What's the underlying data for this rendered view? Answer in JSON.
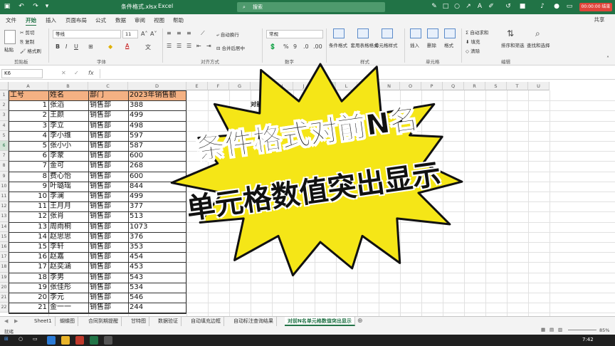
{
  "window": {
    "filename": "条件格式.xlsx",
    "app": "Excel",
    "search_placeholder": "搜索",
    "recording": "00:00:00 结束"
  },
  "ribbon_tabs": [
    "文件",
    "开始",
    "插入",
    "页面布局",
    "公式",
    "数据",
    "审阅",
    "视图",
    "帮助"
  ],
  "share_label": "共享",
  "ribbon": {
    "clipboard": {
      "label": "剪贴板",
      "cut": "剪切",
      "copy": "复制",
      "format_painter": "格式刷",
      "paste": "粘贴"
    },
    "font": {
      "label": "字体",
      "name": "等线",
      "size": "11"
    },
    "alignment": {
      "label": "对齐方式",
      "wrap": "自动换行",
      "merge": "合并后居中"
    },
    "number": {
      "label": "数字",
      "format": "常规"
    },
    "styles": {
      "label": "样式",
      "conditional": "条件格式",
      "table": "套用表格格式",
      "cell_styles": "单元格样式"
    },
    "cells": {
      "label": "单元格",
      "insert": "插入",
      "delete": "删除",
      "format": "格式"
    },
    "editing": {
      "label": "编辑",
      "autosum": "自动求和",
      "fill": "填充",
      "clear": "清除",
      "sort": "排序和筛选",
      "find": "查找和选择"
    }
  },
  "formula_bar": {
    "name_box": "K6",
    "fx": "fx",
    "formula": ""
  },
  "columns": [
    "A",
    "B",
    "C",
    "D",
    "E",
    "F",
    "G",
    "H",
    "I",
    "J",
    "K",
    "L",
    "M",
    "N",
    "O",
    "P",
    "Q",
    "R",
    "S",
    "T",
    "U"
  ],
  "table": {
    "headers": [
      "工号",
      "姓名",
      "部门",
      "2023年销售额"
    ],
    "rows": [
      [
        1,
        "张滔",
        "销售部",
        388
      ],
      [
        2,
        "王颜",
        "销售部",
        499
      ],
      [
        3,
        "李立",
        "销售部",
        498
      ],
      [
        4,
        "李小维",
        "销售部",
        597
      ],
      [
        5,
        "张小小",
        "销售部",
        587
      ],
      [
        6,
        "李蒙",
        "销售部",
        600
      ],
      [
        7,
        "金可",
        "销售部",
        268
      ],
      [
        8,
        "费心怡",
        "销售部",
        600
      ],
      [
        9,
        "叶璐瑶",
        "销售部",
        844
      ],
      [
        10,
        "李澜",
        "销售部",
        499
      ],
      [
        11,
        "王月月",
        "销售部",
        377
      ],
      [
        12,
        "张肖",
        "销售部",
        513
      ],
      [
        13,
        "周雨桐",
        "销售部",
        1073
      ],
      [
        14,
        "赵思思",
        "销售部",
        376
      ],
      [
        15,
        "李轩",
        "销售部",
        353
      ],
      [
        16,
        "赵嘉",
        "销售部",
        454
      ],
      [
        17,
        "赵奕涵",
        "销售部",
        453
      ],
      [
        18,
        "李男",
        "销售部",
        543
      ],
      [
        19,
        "张佳彤",
        "销售部",
        534
      ],
      [
        20,
        "李元",
        "销售部",
        546
      ],
      [
        21,
        "金一一",
        "销售部",
        244
      ]
    ]
  },
  "note_cell": "对前十名的销售",
  "overlay": {
    "line1": "条件格式对前N名",
    "line2": "单元格数值突出显示",
    "burst_color": "#f5e617"
  },
  "sheet_tabs": [
    "Sheet1",
    "蝴蝶图",
    "合同到期提醒",
    "甘特图",
    "数据验证",
    "自动填充边框",
    "自动标注查询结果",
    "对前N名单元格数值突出显示"
  ],
  "active_sheet_index": 7,
  "status": {
    "mode": "就绪",
    "zoom": "85%"
  },
  "taskbar": {
    "time": "7:42"
  },
  "colors": {
    "excel_green": "#217346",
    "header_fill": "#f4b183"
  }
}
